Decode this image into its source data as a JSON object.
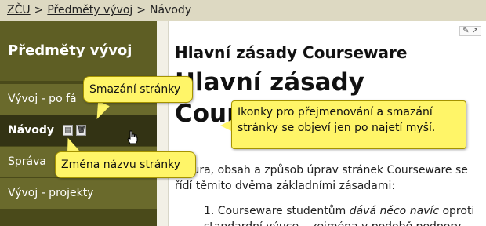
{
  "breadcrumb": {
    "home": "ZČU",
    "section": "Předměty vývoj",
    "current": "Návody",
    "separator": ">"
  },
  "sidebar": {
    "title": "Předměty vývoj",
    "items": [
      {
        "label": "Vývoj - po fá"
      },
      {
        "label": "Návody"
      },
      {
        "label": "Správa"
      },
      {
        "label": "Vývoj - projekty"
      }
    ]
  },
  "content": {
    "edit_icons": "✎ ↗",
    "heading": "Hlavní zásady Courseware",
    "big_heading_line1": "Hlavní zásady",
    "big_heading_line2": "Cour",
    "paragraph_line1": "uktura, obsah a způsob úprav stránek Courseware se",
    "paragraph_line2": "řídí těmito dvěma základními zásadami:",
    "list_item_prefix": "1.  Courseware studentům ",
    "list_item_em": "dává něco navíc",
    "list_item_suffix": " oproti",
    "list_item_line2": "standardní výuce – zejména v podobě podpory"
  },
  "callouts": {
    "delete": "Smazání stránky",
    "rename": "Změna názvu stránky",
    "info": "Ikonky pro přejmenování a smazání stránky se objeví jen po najetí myší."
  },
  "colors": {
    "bubble": "#fff568",
    "sidebar": "#4a4a1a",
    "breadcrumb_bg": "#ddd9c2"
  }
}
